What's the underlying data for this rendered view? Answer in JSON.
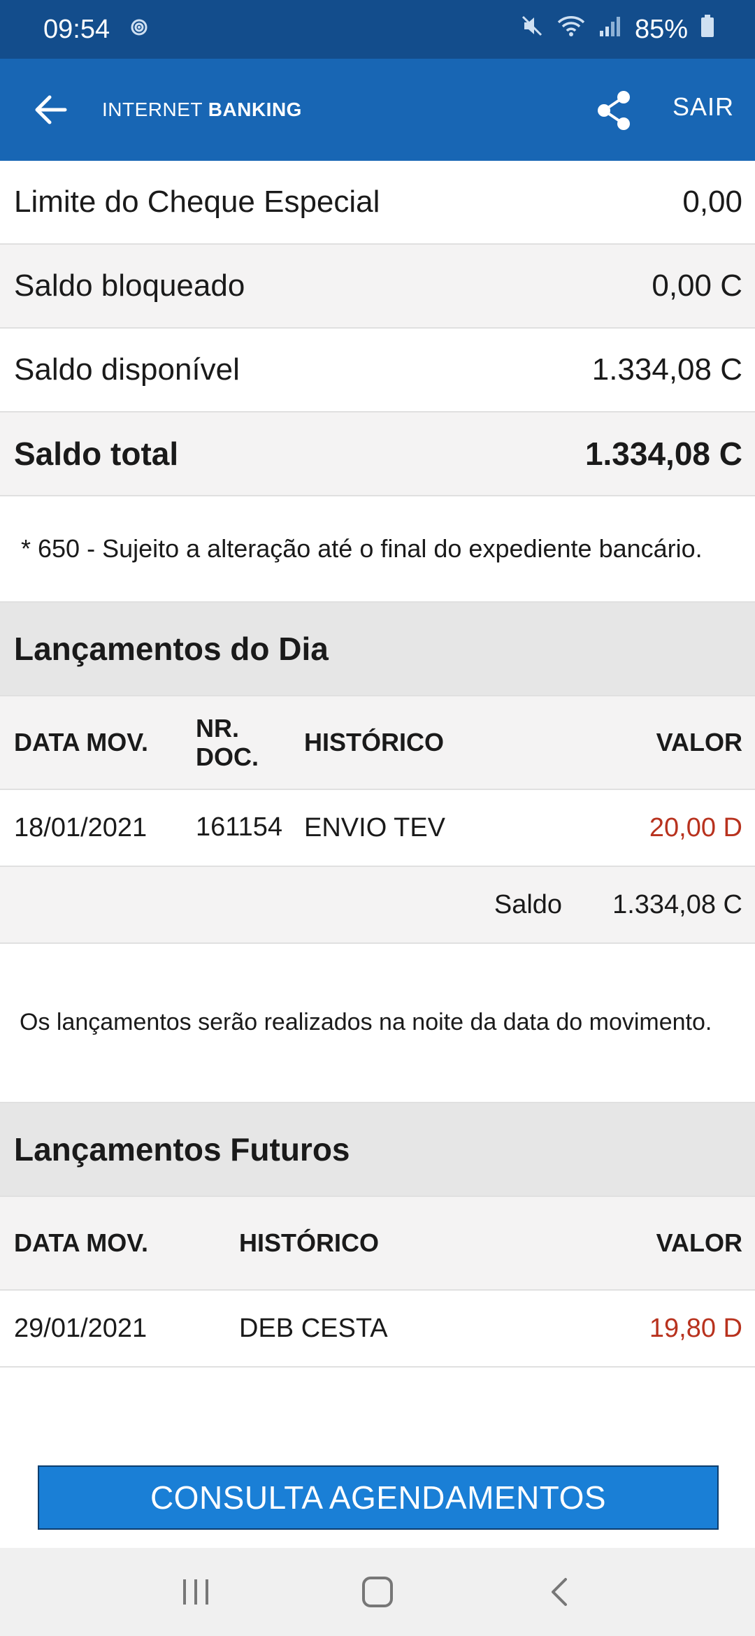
{
  "status_bar": {
    "time": "09:54",
    "battery": "85%"
  },
  "app_bar": {
    "title_light": "INTERNET ",
    "title_bold": "BANKING",
    "sair_label": "SAIR"
  },
  "balances": [
    {
      "label": "Limite do Cheque Especial",
      "value": "0,00"
    },
    {
      "label": "Saldo bloqueado",
      "value": "0,00 C"
    },
    {
      "label": "Saldo disponível",
      "value": "1.334,08 C"
    },
    {
      "label": "Saldo total",
      "value": "1.334,08 C"
    }
  ],
  "note": "* 650 - Sujeito a alteração até o final do expediente bancário.",
  "lancamentos_dia": {
    "title": "Lançamentos do Dia",
    "headers": {
      "date": "DATA MOV.",
      "doc": "NR. DOC.",
      "hist": "HISTÓRICO",
      "value": "VALOR"
    },
    "rows": [
      {
        "date": "18/01/2021",
        "doc": "161154",
        "hist": "ENVIO TEV",
        "value": "20,00 D"
      }
    ],
    "saldo_label": "Saldo",
    "saldo_value": "1.334,08 C"
  },
  "info_text": "Os lançamentos serão realizados na noite da data do movimento.",
  "lancamentos_futuros": {
    "title": "Lançamentos Futuros",
    "headers": {
      "date": "DATA MOV.",
      "hist": "HISTÓRICO",
      "value": "VALOR"
    },
    "rows": [
      {
        "date": "29/01/2021",
        "hist": "DEB CESTA",
        "value": "19,80 D"
      }
    ]
  },
  "action_button": "CONSULTA AGENDAMENTOS",
  "colors": {
    "status_bar": "#134d8c",
    "app_bar": "#1866b4",
    "debit": "#b8321e",
    "button": "#1a7fd6"
  },
  "icons": [
    "back-arrow-icon",
    "share-icon",
    "recent-apps-icon",
    "home-icon",
    "back-icon"
  ]
}
